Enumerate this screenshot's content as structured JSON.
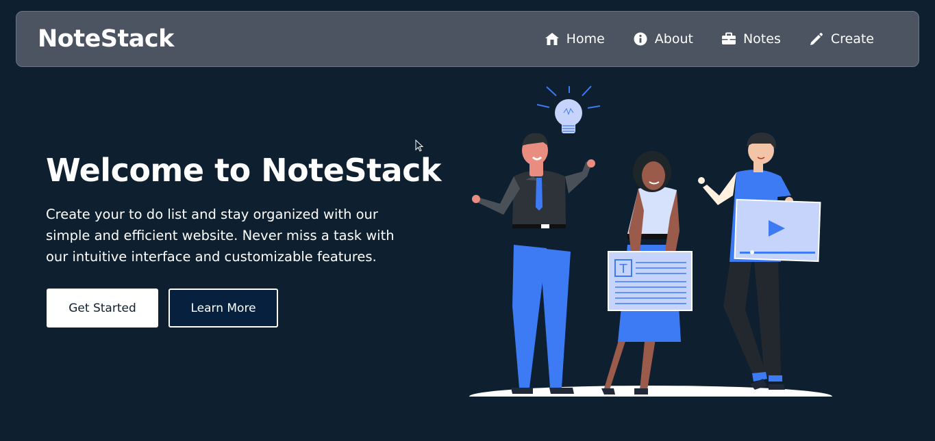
{
  "navbar": {
    "brand": "NoteStack",
    "items": [
      {
        "label": "Home",
        "icon": "home-icon"
      },
      {
        "label": "About",
        "icon": "info-icon"
      },
      {
        "label": "Notes",
        "icon": "briefcase-icon"
      },
      {
        "label": "Create",
        "icon": "pencil-icon"
      }
    ]
  },
  "hero": {
    "title": "Welcome to NoteStack",
    "description": "Create your to do list and stay organized with our simple and efficient website. Never miss a task with our intuitive interface and customizable features.",
    "primary_button": "Get Started",
    "secondary_button": "Learn More",
    "illustration": "team-collaboration-illustration",
    "board_letter": "T"
  },
  "colors": {
    "background": "#0e1f30",
    "navbar": "#4b5460",
    "accent_blue": "#3d7bf4",
    "light_blue": "#c6d4fb"
  }
}
